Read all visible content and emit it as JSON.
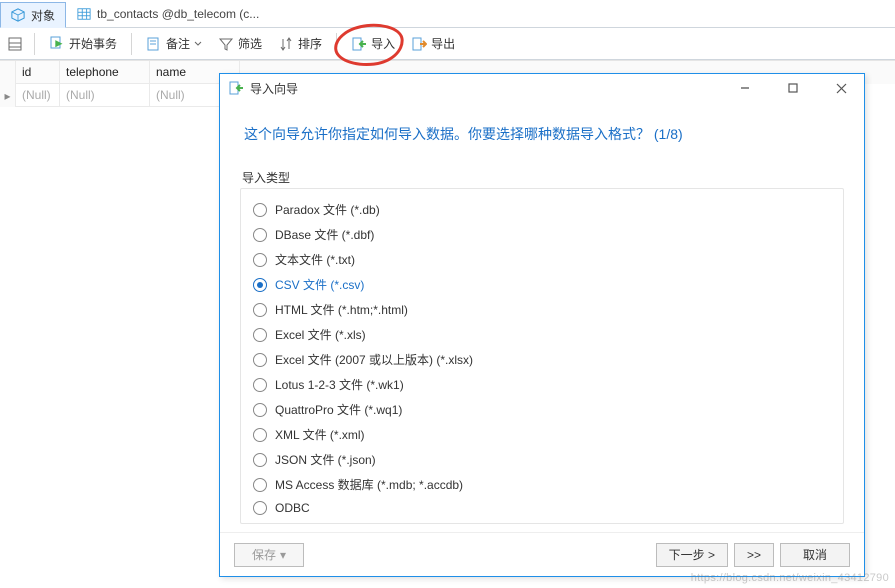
{
  "tabs": {
    "objects": "对象",
    "table": "tb_contacts @db_telecom (c..."
  },
  "toolbar": {
    "begin_tx": "开始事务",
    "memo": "备注",
    "filter": "筛选",
    "sort": "排序",
    "import": "导入",
    "export": "导出"
  },
  "grid": {
    "cols": [
      "id",
      "telephone",
      "name"
    ],
    "row": [
      "(Null)",
      "(Null)",
      "(Null)"
    ]
  },
  "dialog": {
    "title": "导入向导",
    "heading": "这个向导允许你指定如何导入数据。你要选择哪种数据导入格式？ (1/8)",
    "fieldset_label": "导入类型",
    "options": [
      "Paradox 文件 (*.db)",
      "DBase 文件 (*.dbf)",
      "文本文件 (*.txt)",
      "CSV 文件 (*.csv)",
      "HTML 文件 (*.htm;*.html)",
      "Excel 文件 (*.xls)",
      "Excel 文件 (2007 或以上版本) (*.xlsx)",
      "Lotus 1-2-3 文件 (*.wk1)",
      "QuattroPro 文件 (*.wq1)",
      "XML 文件 (*.xml)",
      "JSON 文件 (*.json)",
      "MS Access 数据库 (*.mdb; *.accdb)",
      "ODBC"
    ],
    "selected_index": 3,
    "buttons": {
      "save": "保存",
      "next": "下一步 >",
      "skip": ">>",
      "cancel": "取消"
    }
  },
  "watermark": "https://blog.csdn.net/weixin_43412790",
  "colors": {
    "accent": "#1a6fc7",
    "annotation": "#de3a2f"
  }
}
